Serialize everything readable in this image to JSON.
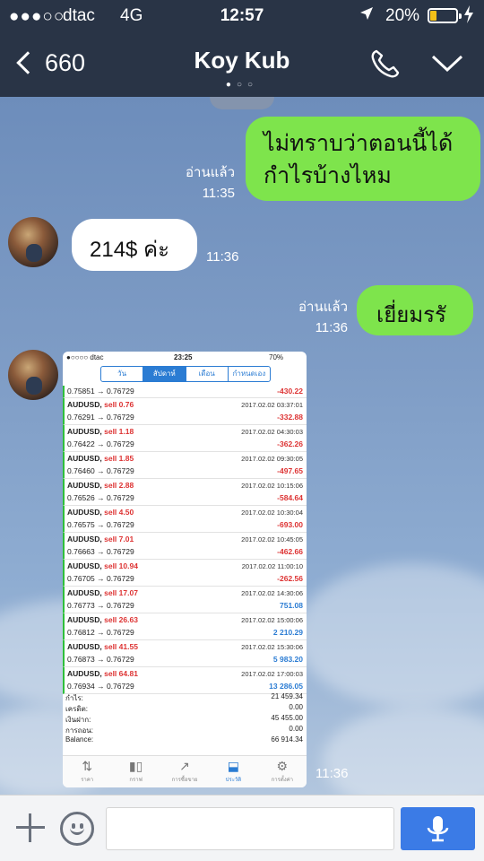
{
  "status_bar": {
    "signal": "●●●○○",
    "carrier": "dtac",
    "network": "4G",
    "time": "12:57",
    "location_icon": "location-arrow-icon",
    "battery_percent": "20%",
    "battery_level": 0.2,
    "battery_color": "#f3c018",
    "charging_icon": "charging-icon"
  },
  "header": {
    "back_count": "660",
    "title": "Koy Kub",
    "page_dots": [
      "●",
      "○",
      "○"
    ],
    "call_icon": "phone-icon",
    "more_icon": "chevron-down-icon"
  },
  "messages": [
    {
      "side": "out",
      "text_line1": "ไม่ทราบว่าตอนนี้ได้",
      "text_line2": "กำไรบ้างไหม",
      "read": "อ่านแล้ว",
      "time": "11:35"
    },
    {
      "side": "in",
      "text": "214$ ค่ะ",
      "time": "11:36"
    },
    {
      "side": "out",
      "text": "เยี่ยมรรั",
      "read": "อ่านแล้ว",
      "time": "11:36"
    },
    {
      "side": "in",
      "type": "image",
      "time": "11:36"
    }
  ],
  "screenshot": {
    "status": {
      "carrier": "●○○○○ dtac",
      "time": "23:25",
      "battery": "70%"
    },
    "segments": [
      "วัน",
      "สัปดาห์",
      "เดือน",
      "กำหนดเอง"
    ],
    "first_row": {
      "prices": "0.75851 → 0.76729",
      "pl": "-430.22"
    },
    "trades": [
      {
        "symbol": "AUDUSD,",
        "side": "sell 0.76",
        "prices": "0.76291 → 0.76729",
        "datetime": "2017.02.02 03:37:01",
        "pl": "-332.88",
        "neg": true
      },
      {
        "symbol": "AUDUSD,",
        "side": "sell 1.18",
        "prices": "0.76422 → 0.76729",
        "datetime": "2017.02.02 04:30:03",
        "pl": "-362.26",
        "neg": true
      },
      {
        "symbol": "AUDUSD,",
        "side": "sell 1.85",
        "prices": "0.76460 → 0.76729",
        "datetime": "2017.02.02 09:30:05",
        "pl": "-497.65",
        "neg": true
      },
      {
        "symbol": "AUDUSD,",
        "side": "sell 2.88",
        "prices": "0.76526 → 0.76729",
        "datetime": "2017.02.02 10:15:06",
        "pl": "-584.64",
        "neg": true
      },
      {
        "symbol": "AUDUSD,",
        "side": "sell 4.50",
        "prices": "0.76575 → 0.76729",
        "datetime": "2017.02.02 10:30:04",
        "pl": "-693.00",
        "neg": true
      },
      {
        "symbol": "AUDUSD,",
        "side": "sell 7.01",
        "prices": "0.76663 → 0.76729",
        "datetime": "2017.02.02 10:45:05",
        "pl": "-462.66",
        "neg": true
      },
      {
        "symbol": "AUDUSD,",
        "side": "sell 10.94",
        "prices": "0.76705 → 0.76729",
        "datetime": "2017.02.02 11:00:10",
        "pl": "-262.56",
        "neg": true
      },
      {
        "symbol": "AUDUSD,",
        "side": "sell 17.07",
        "prices": "0.76773 → 0.76729",
        "datetime": "2017.02.02 14:30:06",
        "pl": "751.08",
        "neg": false
      },
      {
        "symbol": "AUDUSD,",
        "side": "sell 26.63",
        "prices": "0.76812 → 0.76729",
        "datetime": "2017.02.02 15:00:06",
        "pl": "2 210.29",
        "neg": false
      },
      {
        "symbol": "AUDUSD,",
        "side": "sell 41.55",
        "prices": "0.76873 → 0.76729",
        "datetime": "2017.02.02 15:30:06",
        "pl": "5 983.20",
        "neg": false
      },
      {
        "symbol": "AUDUSD,",
        "side": "sell 64.81",
        "prices": "0.76934 → 0.76729",
        "datetime": "2017.02.02 17:00:03",
        "pl": "13 286.05",
        "neg": false
      }
    ],
    "summary": [
      {
        "label": "กำไร:",
        "value": "21 459.34"
      },
      {
        "label": "เครดิต:",
        "value": "0.00"
      },
      {
        "label": "เงินฝาก:",
        "value": "45 455.00"
      },
      {
        "label": "การถอน:",
        "value": "0.00"
      },
      {
        "label": "Balance:",
        "value": "66 914.34"
      }
    ],
    "tabs": [
      {
        "label": "ราคา",
        "icon": "quotes-icon",
        "glyph": "⇅"
      },
      {
        "label": "กราฟ",
        "icon": "candlestick-icon",
        "glyph": "▮▯"
      },
      {
        "label": "การซื้อขาย",
        "icon": "trade-chart-icon",
        "glyph": "↗"
      },
      {
        "label": "ประวัติ",
        "icon": "history-inbox-icon",
        "glyph": "⬓"
      },
      {
        "label": "การตั้งค่า",
        "icon": "gear-icon",
        "glyph": "⚙"
      }
    ]
  },
  "input_bar": {
    "plus_icon": "plus-icon",
    "emoji_icon": "emoji-icon",
    "message_value": "",
    "mic_icon": "microphone-icon",
    "mic_color": "#3b7be6"
  }
}
